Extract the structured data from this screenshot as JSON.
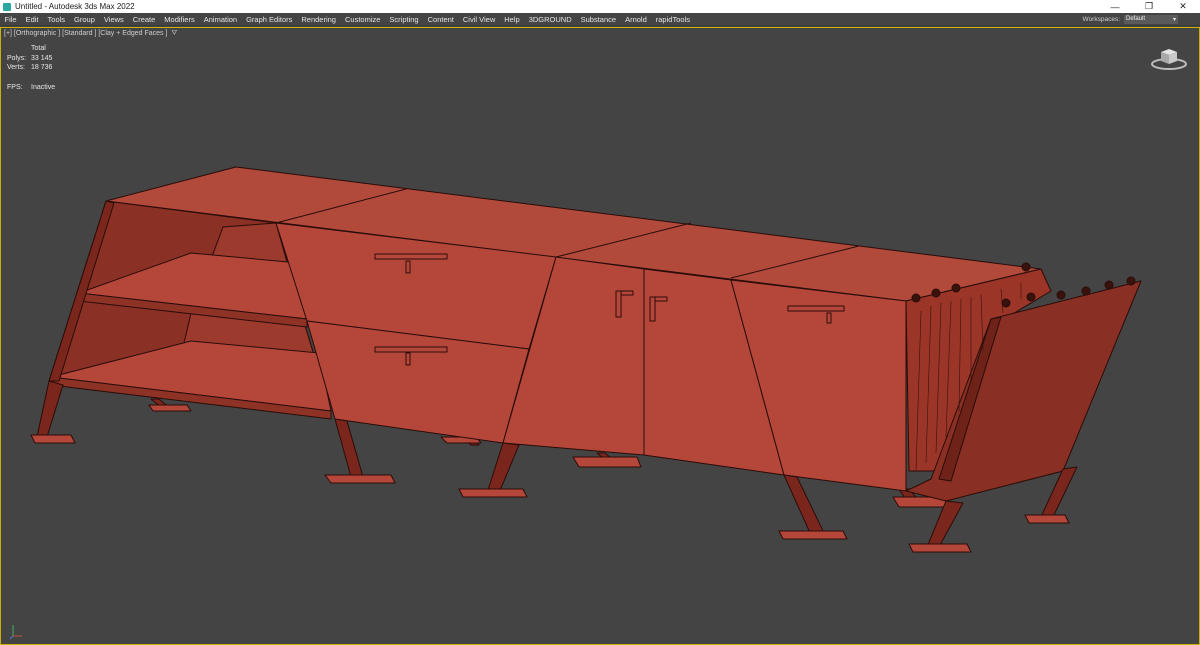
{
  "window": {
    "title": "Untitled - Autodesk 3ds Max 2022",
    "minimize_glyph": "—",
    "restore_glyph": "❐",
    "close_glyph": "✕"
  },
  "menu": [
    "File",
    "Edit",
    "Tools",
    "Group",
    "Views",
    "Create",
    "Modifiers",
    "Animation",
    "Graph Editors",
    "Rendering",
    "Customize",
    "Scripting",
    "Content",
    "Civil View",
    "Help",
    "3DGROUND",
    "Substance",
    "Arnold",
    "rapidTools"
  ],
  "workspaces": {
    "label": "Workspaces:",
    "value": "Default"
  },
  "viewport": {
    "label": "[+] [Orthographic ] [Standard ] [Clay + Edged Faces ]",
    "stats": {
      "header": "Total",
      "polys_label": "Polys:",
      "polys_value": "33 145",
      "verts_label": "Verts:",
      "verts_value": "18 736",
      "fps_label": "FPS:",
      "fps_value": "Inactive"
    }
  },
  "colors": {
    "viewport_bg": "#444444",
    "clay_face": "#b5473a",
    "clay_dark": "#7a261d",
    "edge": "#2a0c08",
    "active_border": "#c8b400"
  }
}
